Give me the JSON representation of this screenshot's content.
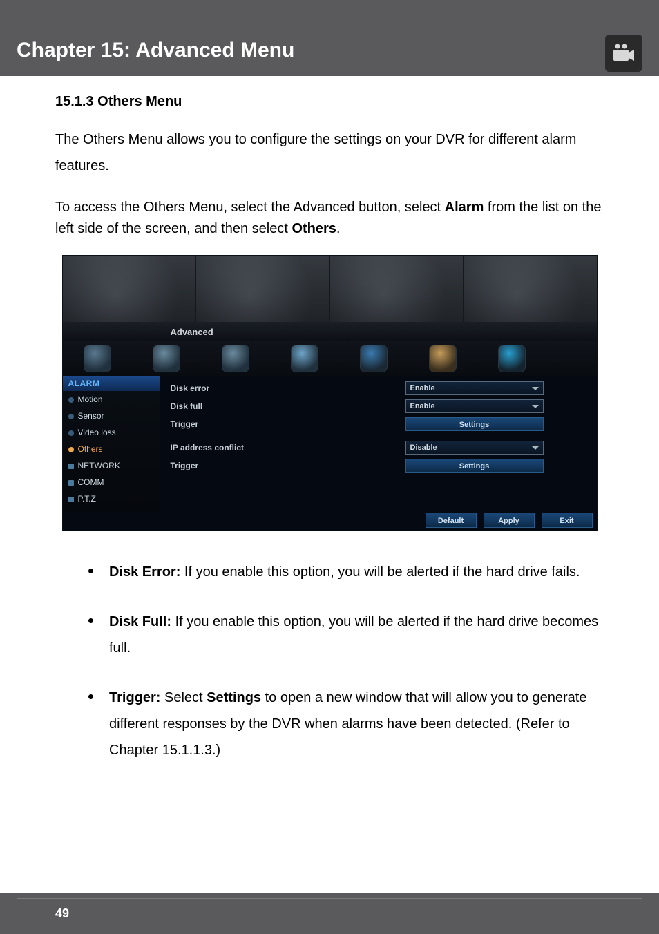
{
  "header": {
    "chapter_title": "Chapter 15: Advanced Menu"
  },
  "section": {
    "title": "15.1.3 Others Menu",
    "intro_para": "The Others Menu allows you to configure the settings on your DVR for different alarm features.",
    "access_text_prefix": "To access the Others Menu, select the Advanced button, select ",
    "access_bold1": "Alarm",
    "access_text_mid": " from the list on the left side of the screen, and then select ",
    "access_bold2": "Others",
    "access_text_suffix": "."
  },
  "screenshot": {
    "advanced_label": "Advanced",
    "sidebar": {
      "section1": "ALARM",
      "items1": [
        "Motion",
        "Sensor",
        "Video loss",
        "Others"
      ],
      "active_item": "Others",
      "items2": [
        "NETWORK",
        "COMM",
        "P.T.Z"
      ]
    },
    "settings": {
      "rows": [
        {
          "label": "Disk error",
          "type": "dropdown",
          "value": "Enable"
        },
        {
          "label": "Disk full",
          "type": "dropdown",
          "value": "Enable"
        },
        {
          "label": "Trigger",
          "type": "button",
          "value": "Settings"
        },
        {
          "label": "IP address conflict",
          "type": "dropdown",
          "value": "Disable"
        },
        {
          "label": "Trigger",
          "type": "button",
          "value": "Settings"
        }
      ]
    },
    "buttons": {
      "default": "Default",
      "apply": "Apply",
      "exit": "Exit"
    }
  },
  "bullets": [
    {
      "label": "Disk Error:",
      "text": " If you enable this option, you will be alerted if the hard drive fails."
    },
    {
      "label": "Disk Full:",
      "text": " If you enable this option, you will be alerted if the hard drive becomes full."
    },
    {
      "label": "Trigger:",
      "text_before": " Select ",
      "bold_inner": "Settings",
      "text_after": " to open a new window that will allow you to generate different responses by the DVR when alarms have been detected. (Refer to Chapter 15.1.1.3.)"
    }
  ],
  "footer": {
    "page_number": "49"
  }
}
